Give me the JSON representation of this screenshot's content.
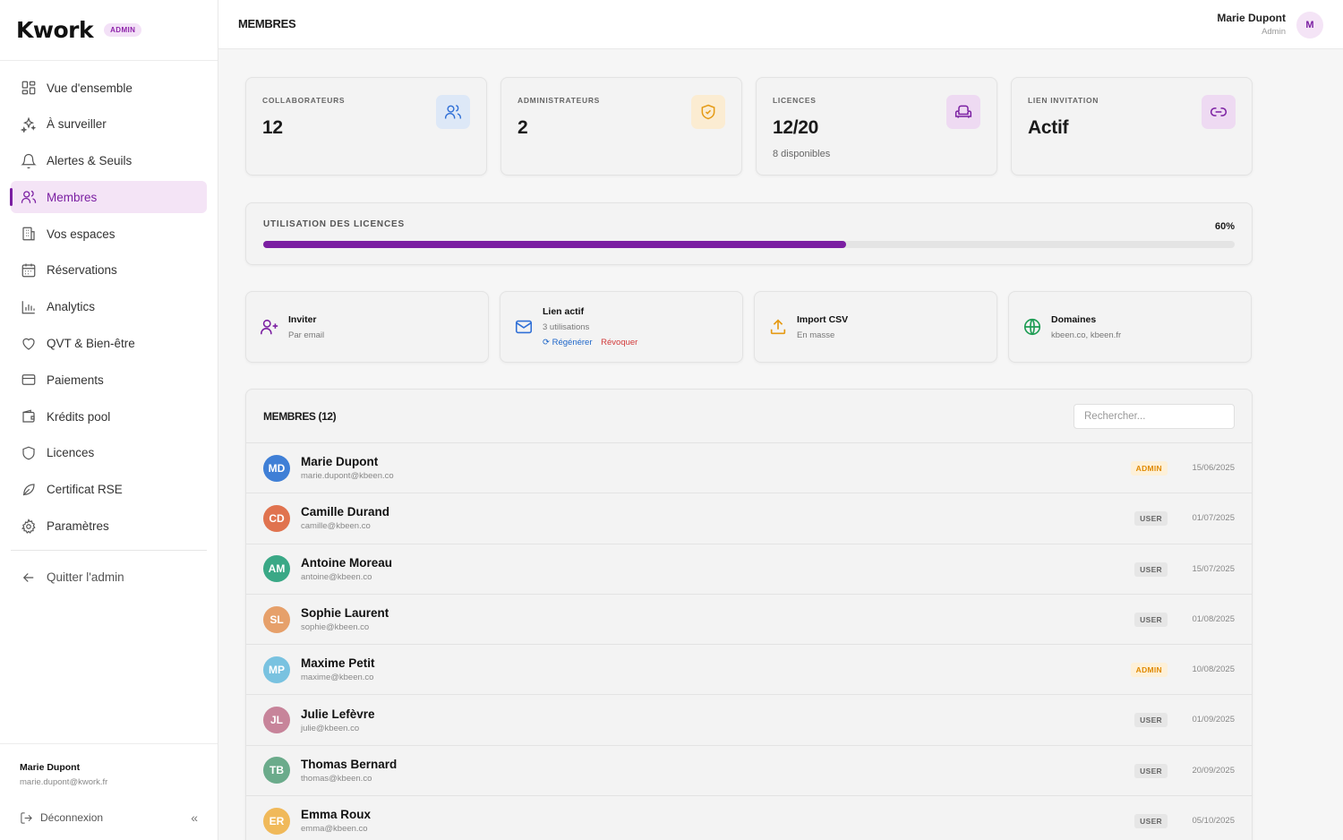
{
  "brand": {
    "logo": "Kwork",
    "badge": "ADMIN"
  },
  "sidebar": {
    "items": [
      {
        "label": "Vue d'ensemble",
        "icon": "grid-icon"
      },
      {
        "label": "À surveiller",
        "icon": "sparkle-icon"
      },
      {
        "label": "Alertes & Seuils",
        "icon": "bell-icon"
      },
      {
        "label": "Membres",
        "icon": "users-icon",
        "active": true
      },
      {
        "label": "Vos espaces",
        "icon": "building-icon"
      },
      {
        "label": "Réservations",
        "icon": "calendar-icon"
      },
      {
        "label": "Analytics",
        "icon": "bar-chart-icon"
      },
      {
        "label": "QVT & Bien-être",
        "icon": "heart-icon"
      },
      {
        "label": "Paiements",
        "icon": "credit-card-icon"
      },
      {
        "label": "Krédits pool",
        "icon": "wallet-icon"
      },
      {
        "label": "Licences",
        "icon": "shield-icon"
      },
      {
        "label": "Certificat RSE",
        "icon": "leaf-icon"
      },
      {
        "label": "Paramètres",
        "icon": "gear-icon"
      }
    ],
    "quit": "Quitter l'admin",
    "footer": {
      "name": "Marie Dupont",
      "email": "marie.dupont@kwork.fr",
      "logout": "Déconnexion"
    }
  },
  "header": {
    "title": "MEMBRES",
    "user_name": "Marie Dupont",
    "user_role": "Admin",
    "avatar_initial": "M"
  },
  "stats": [
    {
      "label": "COLLABORATEURS",
      "value": "12",
      "sub": "",
      "icon": "users-icon",
      "color": "#2f6fd6",
      "bg": "#dde8f7"
    },
    {
      "label": "ADMINISTRATEURS",
      "value": "2",
      "sub": "",
      "icon": "shield-check-icon",
      "color": "#e59a14",
      "bg": "#fbecd2"
    },
    {
      "label": "LICENCES",
      "value": "12/20",
      "sub": "8 disponibles",
      "icon": "armchair-icon",
      "color": "#7b1fa2",
      "bg": "#eedaf2"
    },
    {
      "label": "LIEN INVITATION",
      "value": "Actif",
      "sub": "",
      "icon": "link-icon",
      "color": "#7b1fa2",
      "bg": "#eedaf2"
    }
  ],
  "usage": {
    "label": "UTILISATION DES LICENCES",
    "percent_label": "60%",
    "percent": 60,
    "color": "#7b1fa2"
  },
  "actions": {
    "invite": {
      "title": "Inviter",
      "sub": "Par email"
    },
    "link": {
      "title": "Lien actif",
      "sub": "3 utilisations",
      "regen": "Régénérer",
      "revoke": "Révoquer"
    },
    "csv": {
      "title": "Import CSV",
      "sub": "En masse"
    },
    "domains": {
      "title": "Domaines",
      "sub": "kbeen.co, kbeen.fr"
    }
  },
  "members": {
    "title": "MEMBRES (12)",
    "search_placeholder": "Rechercher...",
    "rows": [
      {
        "initials": "MD",
        "name": "Marie Dupont",
        "email": "marie.dupont@kbeen.co",
        "role": "ADMIN",
        "date": "15/06/2025",
        "color": "#3f7fd6"
      },
      {
        "initials": "CD",
        "name": "Camille Durand",
        "email": "camille@kbeen.co",
        "role": "USER",
        "date": "01/07/2025",
        "color": "#e0734f"
      },
      {
        "initials": "AM",
        "name": "Antoine Moreau",
        "email": "antoine@kbeen.co",
        "role": "USER",
        "date": "15/07/2025",
        "color": "#3aa886"
      },
      {
        "initials": "SL",
        "name": "Sophie Laurent",
        "email": "sophie@kbeen.co",
        "role": "USER",
        "date": "01/08/2025",
        "color": "#e6a06a"
      },
      {
        "initials": "MP",
        "name": "Maxime Petit",
        "email": "maxime@kbeen.co",
        "role": "ADMIN",
        "date": "10/08/2025",
        "color": "#79c2e0"
      },
      {
        "initials": "JL",
        "name": "Julie Lefèvre",
        "email": "julie@kbeen.co",
        "role": "USER",
        "date": "01/09/2025",
        "color": "#c7849a"
      },
      {
        "initials": "TB",
        "name": "Thomas Bernard",
        "email": "thomas@kbeen.co",
        "role": "USER",
        "date": "20/09/2025",
        "color": "#6bab8b"
      },
      {
        "initials": "ER",
        "name": "Emma Roux",
        "email": "emma@kbeen.co",
        "role": "USER",
        "date": "05/10/2025",
        "color": "#f0b95a"
      }
    ]
  }
}
